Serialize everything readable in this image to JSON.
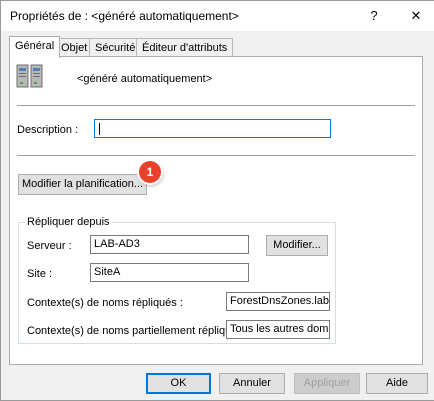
{
  "window": {
    "title": "Propriétés de : <généré automatiquement>",
    "help_label": "?",
    "close_label": "✕"
  },
  "tabs": [
    {
      "label": "Général",
      "active": true
    },
    {
      "label": "Objet",
      "active": false
    },
    {
      "label": "Sécurité",
      "active": false
    },
    {
      "label": "Éditeur d'attributs",
      "active": false
    }
  ],
  "general": {
    "object_name": "<généré automatiquement>",
    "icon": "server-icon",
    "description_label": "Description :",
    "description_value": "",
    "modify_schedule_label": "Modifier la planification...",
    "badge_number": "1",
    "badge_color": "#e8412c"
  },
  "replicate_from": {
    "group_title": "Répliquer depuis",
    "server_label": "Serveur :",
    "server_value": "LAB-AD3",
    "modify_label": "Modifier...",
    "site_label": "Site :",
    "site_value": "SiteA",
    "replicated_nc_label": "Contexte(s) de noms répliqués :",
    "replicated_nc_value": "ForestDnsZones.lab.intra",
    "partial_nc_label": "Contexte(s) de noms partiellement répliqués :",
    "partial_nc_value": "Tous les autres domaines"
  },
  "footer": {
    "ok_label": "OK",
    "cancel_label": "Annuler",
    "apply_label": "Appliquer",
    "help_label": "Aide"
  },
  "colors": {
    "accent": "#0078d7",
    "window_bg": "#f0f0f0",
    "panel_bg": "#ffffff"
  }
}
